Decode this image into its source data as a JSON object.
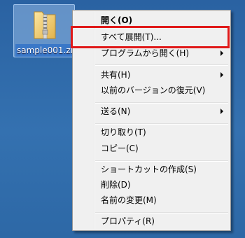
{
  "desktop": {
    "file": {
      "name": "sample001.zip",
      "icon": "zip-folder-icon"
    }
  },
  "context_menu": {
    "items": [
      {
        "label": "開く(O)",
        "default": true,
        "submenu": false
      },
      {
        "label": "すべて展開(T)...",
        "default": false,
        "submenu": false,
        "highlighted": true
      },
      {
        "label": "プログラムから開く(H)",
        "default": false,
        "submenu": true
      },
      {
        "label": "共有(H)",
        "default": false,
        "submenu": true
      },
      {
        "label": "以前のバージョンの復元(V)",
        "default": false,
        "submenu": false
      },
      {
        "label": "送る(N)",
        "default": false,
        "submenu": true
      },
      {
        "label": "切り取り(T)",
        "default": false,
        "submenu": false
      },
      {
        "label": "コピー(C)",
        "default": false,
        "submenu": false
      },
      {
        "label": "ショートカットの作成(S)",
        "default": false,
        "submenu": false
      },
      {
        "label": "削除(D)",
        "default": false,
        "submenu": false
      },
      {
        "label": "名前の変更(M)",
        "default": false,
        "submenu": false
      },
      {
        "label": "プロパティ(R)",
        "default": false,
        "submenu": false
      }
    ]
  },
  "colors": {
    "desktop_bg": "#2f6aa8",
    "menu_bg": "#f0f0f0",
    "highlight_border": "#e01a1a"
  }
}
